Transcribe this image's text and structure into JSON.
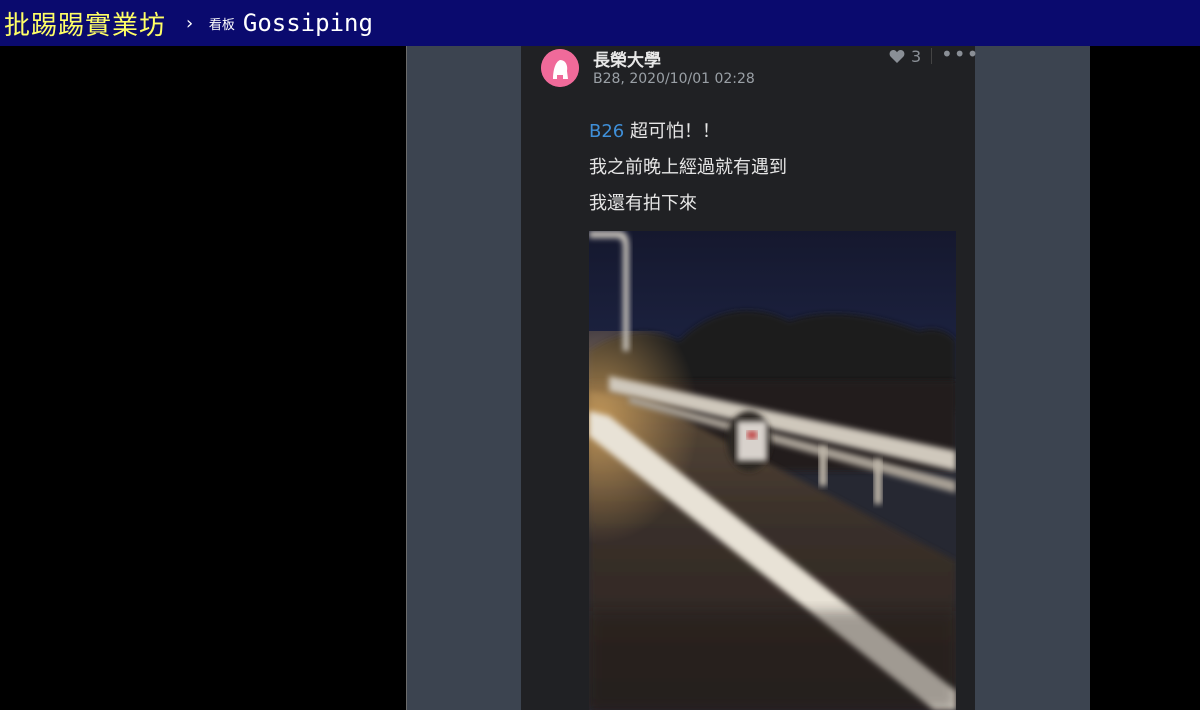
{
  "header": {
    "site_title": "批踢踢實業坊",
    "breadcrumb_separator": "›",
    "board_label": "看板",
    "board_name": "Gossiping"
  },
  "post": {
    "author": "長榮大學",
    "meta": "B28, 2020/10/01 02:28",
    "likes": "3",
    "more": "•••",
    "reply_ref": "B26",
    "line1": "超可怕！！",
    "line2": "我之前晚上經過就有遇到",
    "line3": "我還有拍下來"
  },
  "colors": {
    "topbar_bg": "#0a0a6e",
    "site_title": "#ffff66",
    "frame_bg": "#3c4450",
    "card_bg": "#202124",
    "reply_ref": "#3f8fd8",
    "avatar": "#f06a9a"
  },
  "icons": {
    "like": "heart-icon",
    "more": "more-dots-icon",
    "avatar": "female-avatar-icon"
  }
}
